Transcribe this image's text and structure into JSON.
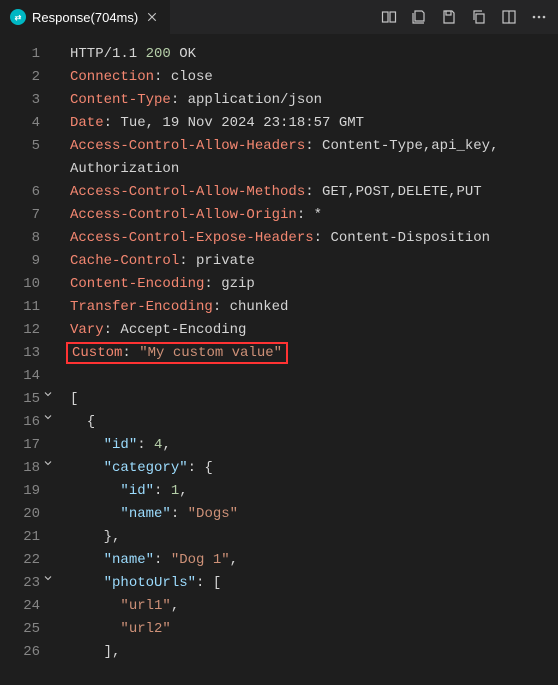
{
  "tab": {
    "title": "Response(704ms)"
  },
  "lines": [
    {
      "n": 1,
      "fold": null,
      "segs": [
        [
          "HTTP/1.1 ",
          "tok-default"
        ],
        [
          "200",
          "tok-num"
        ],
        [
          " OK",
          "tok-default"
        ]
      ]
    },
    {
      "n": 2,
      "fold": null,
      "segs": [
        [
          "Connection",
          "tok-header"
        ],
        [
          ": close",
          "tok-default"
        ]
      ]
    },
    {
      "n": 3,
      "fold": null,
      "segs": [
        [
          "Content-Type",
          "tok-header"
        ],
        [
          ": application/json",
          "tok-default"
        ]
      ]
    },
    {
      "n": 4,
      "fold": null,
      "segs": [
        [
          "Date",
          "tok-header"
        ],
        [
          ": Tue, 19 Nov 2024 23:18:57 GMT",
          "tok-default"
        ]
      ]
    },
    {
      "n": 5,
      "fold": null,
      "segs": [
        [
          "Access-Control-Allow-Headers",
          "tok-header"
        ],
        [
          ": Content-Type,api_key,",
          "tok-default"
        ]
      ]
    },
    {
      "n": null,
      "fold": null,
      "segs": [
        [
          "Authorization",
          "tok-default"
        ]
      ]
    },
    {
      "n": 6,
      "fold": null,
      "segs": [
        [
          "Access-Control-Allow-Methods",
          "tok-header"
        ],
        [
          ": GET,POST,DELETE,PUT",
          "tok-default"
        ]
      ]
    },
    {
      "n": 7,
      "fold": null,
      "segs": [
        [
          "Access-Control-Allow-Origin",
          "tok-header"
        ],
        [
          ": *",
          "tok-default"
        ]
      ]
    },
    {
      "n": 8,
      "fold": null,
      "segs": [
        [
          "Access-Control-Expose-Headers",
          "tok-header"
        ],
        [
          ": Content-Disposition",
          "tok-default"
        ]
      ]
    },
    {
      "n": 9,
      "fold": null,
      "segs": [
        [
          "Cache-Control",
          "tok-header"
        ],
        [
          ": private",
          "tok-default"
        ]
      ]
    },
    {
      "n": 10,
      "fold": null,
      "segs": [
        [
          "Content-Encoding",
          "tok-header"
        ],
        [
          ": gzip",
          "tok-default"
        ]
      ]
    },
    {
      "n": 11,
      "fold": null,
      "segs": [
        [
          "Transfer-Encoding",
          "tok-header"
        ],
        [
          ": chunked",
          "tok-default"
        ]
      ]
    },
    {
      "n": 12,
      "fold": null,
      "segs": [
        [
          "Vary",
          "tok-header"
        ],
        [
          ": Accept-Encoding",
          "tok-default"
        ]
      ]
    },
    {
      "n": 13,
      "fold": null,
      "highlight": true,
      "segs": [
        [
          "Custom",
          "tok-header"
        ],
        [
          ": ",
          "tok-default"
        ],
        [
          "\"My custom value\"",
          "tok-str"
        ]
      ]
    },
    {
      "n": 14,
      "fold": null,
      "segs": []
    },
    {
      "n": 15,
      "fold": "open",
      "segs": [
        [
          "[",
          "tok-punct"
        ]
      ]
    },
    {
      "n": 16,
      "fold": "open",
      "segs": [
        [
          "  {",
          "tok-punct"
        ]
      ]
    },
    {
      "n": 17,
      "fold": null,
      "segs": [
        [
          "    ",
          "tok-default"
        ],
        [
          "\"id\"",
          "tok-key"
        ],
        [
          ": ",
          "tok-punct"
        ],
        [
          "4",
          "tok-num"
        ],
        [
          ",",
          "tok-punct"
        ]
      ]
    },
    {
      "n": 18,
      "fold": "open",
      "segs": [
        [
          "    ",
          "tok-default"
        ],
        [
          "\"category\"",
          "tok-key"
        ],
        [
          ": {",
          "tok-punct"
        ]
      ]
    },
    {
      "n": 19,
      "fold": null,
      "segs": [
        [
          "      ",
          "tok-default"
        ],
        [
          "\"id\"",
          "tok-key"
        ],
        [
          ": ",
          "tok-punct"
        ],
        [
          "1",
          "tok-num"
        ],
        [
          ",",
          "tok-punct"
        ]
      ]
    },
    {
      "n": 20,
      "fold": null,
      "segs": [
        [
          "      ",
          "tok-default"
        ],
        [
          "\"name\"",
          "tok-key"
        ],
        [
          ": ",
          "tok-punct"
        ],
        [
          "\"Dogs\"",
          "tok-str"
        ]
      ]
    },
    {
      "n": 21,
      "fold": null,
      "segs": [
        [
          "    },",
          "tok-punct"
        ]
      ]
    },
    {
      "n": 22,
      "fold": null,
      "segs": [
        [
          "    ",
          "tok-default"
        ],
        [
          "\"name\"",
          "tok-key"
        ],
        [
          ": ",
          "tok-punct"
        ],
        [
          "\"Dog 1\"",
          "tok-str"
        ],
        [
          ",",
          "tok-punct"
        ]
      ]
    },
    {
      "n": 23,
      "fold": "open",
      "segs": [
        [
          "    ",
          "tok-default"
        ],
        [
          "\"photoUrls\"",
          "tok-key"
        ],
        [
          ": [",
          "tok-punct"
        ]
      ]
    },
    {
      "n": 24,
      "fold": null,
      "segs": [
        [
          "      ",
          "tok-default"
        ],
        [
          "\"url1\"",
          "tok-str"
        ],
        [
          ",",
          "tok-punct"
        ]
      ]
    },
    {
      "n": 25,
      "fold": null,
      "segs": [
        [
          "      ",
          "tok-default"
        ],
        [
          "\"url2\"",
          "tok-str"
        ]
      ]
    },
    {
      "n": 26,
      "fold": null,
      "segs": [
        [
          "    ],",
          "tok-punct"
        ]
      ]
    }
  ]
}
